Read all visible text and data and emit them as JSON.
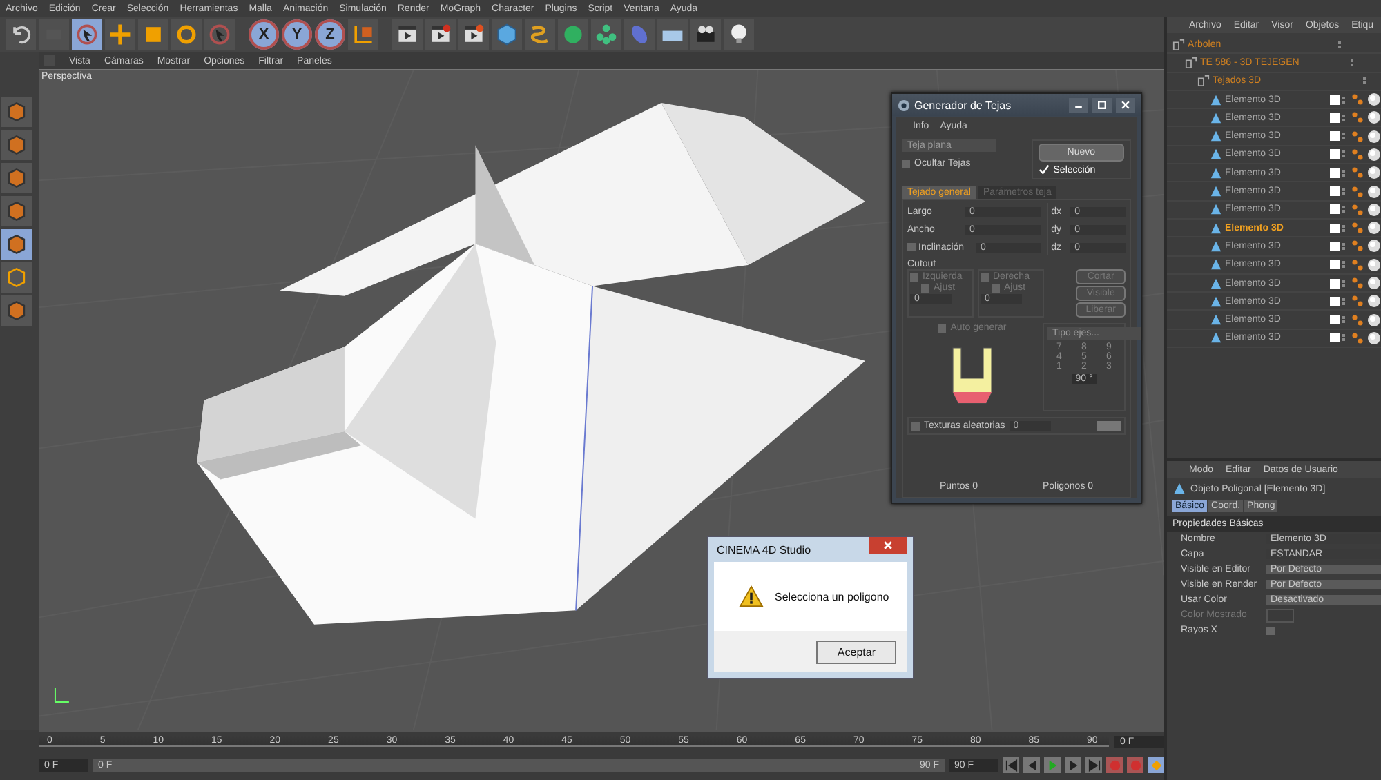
{
  "menu": [
    "Archivo",
    "Edición",
    "Crear",
    "Selección",
    "Herramientas",
    "Malla",
    "Animación",
    "Simulación",
    "Render",
    "MoGraph",
    "Character",
    "Plugins",
    "Script",
    "Ventana",
    "Ayuda"
  ],
  "toolbar": {
    "axes": [
      "X",
      "Y",
      "Z"
    ]
  },
  "left_tools": [
    {
      "selected": false
    },
    {
      "selected": false
    },
    {
      "selected": false
    },
    {
      "selected": false
    },
    {
      "selected": true
    },
    {
      "selected": false
    },
    {
      "selected": false
    }
  ],
  "viewport": {
    "menu": [
      "Vista",
      "Cámaras",
      "Mostrar",
      "Opciones",
      "Filtrar",
      "Paneles"
    ],
    "title": "Perspectiva"
  },
  "objects": {
    "menu": [
      "Archivo",
      "Editar",
      "Visor",
      "Objetos",
      "Etiqu"
    ],
    "tree": [
      {
        "name": "Arbolen",
        "kind": "null",
        "selected": false,
        "children": [
          {
            "name": "TE 586 - 3D TEJEGEN",
            "kind": "null",
            "selected": false,
            "children": [
              {
                "name": "Tejados 3D",
                "kind": "null",
                "selected": false,
                "children": [
                  {
                    "name": "Elemento 3D",
                    "kind": "poly",
                    "selected": false
                  },
                  {
                    "name": "Elemento 3D",
                    "kind": "poly",
                    "selected": false
                  },
                  {
                    "name": "Elemento 3D",
                    "kind": "poly",
                    "selected": false
                  },
                  {
                    "name": "Elemento 3D",
                    "kind": "poly",
                    "selected": false
                  },
                  {
                    "name": "Elemento 3D",
                    "kind": "poly",
                    "selected": false
                  },
                  {
                    "name": "Elemento 3D",
                    "kind": "poly",
                    "selected": false
                  },
                  {
                    "name": "Elemento 3D",
                    "kind": "poly",
                    "selected": false
                  },
                  {
                    "name": "Elemento 3D",
                    "kind": "poly",
                    "selected": true
                  },
                  {
                    "name": "Elemento 3D",
                    "kind": "poly",
                    "selected": false
                  },
                  {
                    "name": "Elemento 3D",
                    "kind": "poly",
                    "selected": false
                  },
                  {
                    "name": "Elemento 3D",
                    "kind": "poly",
                    "selected": false
                  },
                  {
                    "name": "Elemento 3D",
                    "kind": "poly",
                    "selected": false
                  },
                  {
                    "name": "Elemento 3D",
                    "kind": "poly",
                    "selected": false
                  },
                  {
                    "name": "Elemento 3D",
                    "kind": "poly",
                    "selected": false
                  }
                ]
              }
            ]
          }
        ]
      }
    ]
  },
  "attributes": {
    "menu": [
      "Modo",
      "Editar",
      "Datos de Usuario"
    ],
    "title": "Objeto Poligonal [Elemento 3D]",
    "tabs": [
      {
        "label": "Básico",
        "selected": true
      },
      {
        "label": "Coord.",
        "selected": false
      },
      {
        "label": "Phong",
        "selected": false
      }
    ],
    "section": "Propiedades Básicas",
    "fields": [
      {
        "label": "Nombre",
        "kind": "text",
        "value": "Elemento 3D",
        "disabled": false
      },
      {
        "label": "Capa",
        "kind": "text",
        "value": "ESTANDAR",
        "disabled": false
      },
      {
        "label": "Visible en Editor",
        "kind": "select",
        "value": "Por Defecto",
        "disabled": false
      },
      {
        "label": "Visible en Render",
        "kind": "select",
        "value": "Por Defecto",
        "disabled": false
      },
      {
        "label": "Usar Color",
        "kind": "select",
        "value": "Desactivado",
        "disabled": false
      },
      {
        "label": "Color Mostrado",
        "kind": "swatch",
        "disabled": true
      },
      {
        "label": "Rayos X",
        "kind": "check",
        "checked": false,
        "disabled": false
      }
    ]
  },
  "generator": {
    "title": "Generador de Tejas",
    "menu": [
      "Info",
      "Ayuda"
    ],
    "dropdown": "Teja plana",
    "hide": {
      "label": "Ocultar Tejas",
      "checked": false
    },
    "new_button": "Nuevo",
    "selection": {
      "label": "Selección",
      "checked": true
    },
    "tabs": [
      {
        "label": "Tejado general",
        "selected": true
      },
      {
        "label": "Parámetros teja",
        "selected": false
      }
    ],
    "left_fields": [
      {
        "label": "Largo",
        "value": "0",
        "kind": "plain"
      },
      {
        "label": "Ancho",
        "value": "0",
        "kind": "plain"
      },
      {
        "label": "Inclinación",
        "value": "0",
        "kind": "check",
        "checked": false
      }
    ],
    "right_fields": [
      {
        "label": "dx",
        "value": "0"
      },
      {
        "label": "dy",
        "value": "0"
      },
      {
        "label": "dz",
        "value": "0"
      }
    ],
    "cutout": {
      "title": "Cutout",
      "sides": [
        {
          "label": "Izquierda",
          "checked": false,
          "adjust": {
            "label": "Ajust",
            "checked": false
          },
          "value": "0"
        },
        {
          "label": "Derecha",
          "checked": false,
          "adjust": {
            "label": "Ajust",
            "checked": false
          },
          "value": "0"
        }
      ],
      "buttons": [
        "Cortar",
        "Visible",
        "Liberar"
      ]
    },
    "auto": {
      "label": "Auto generar",
      "checked": false
    },
    "axes_dropdown": "Tipo ejes...",
    "keypad": [
      "7",
      "8",
      "9",
      "4",
      "5",
      "6",
      "1",
      "2",
      "3"
    ],
    "angle": "90 °",
    "textures": {
      "label": "Texturas aleatorias",
      "checked": false,
      "value": "0"
    },
    "points": "Puntos 0",
    "polygons": "Poligonos 0"
  },
  "message": {
    "title": "CINEMA 4D Studio",
    "text": "Selecciona un poligono",
    "button": "Aceptar"
  },
  "timeline": {
    "ticks": [
      "0",
      "5",
      "10",
      "15",
      "20",
      "25",
      "30",
      "35",
      "40",
      "45",
      "50",
      "55",
      "60",
      "65",
      "70",
      "75",
      "80",
      "85",
      "90"
    ],
    "current": "0 F",
    "start": "0 F",
    "range_start": "0 F",
    "range_end": "90 F",
    "end": "90 F"
  }
}
